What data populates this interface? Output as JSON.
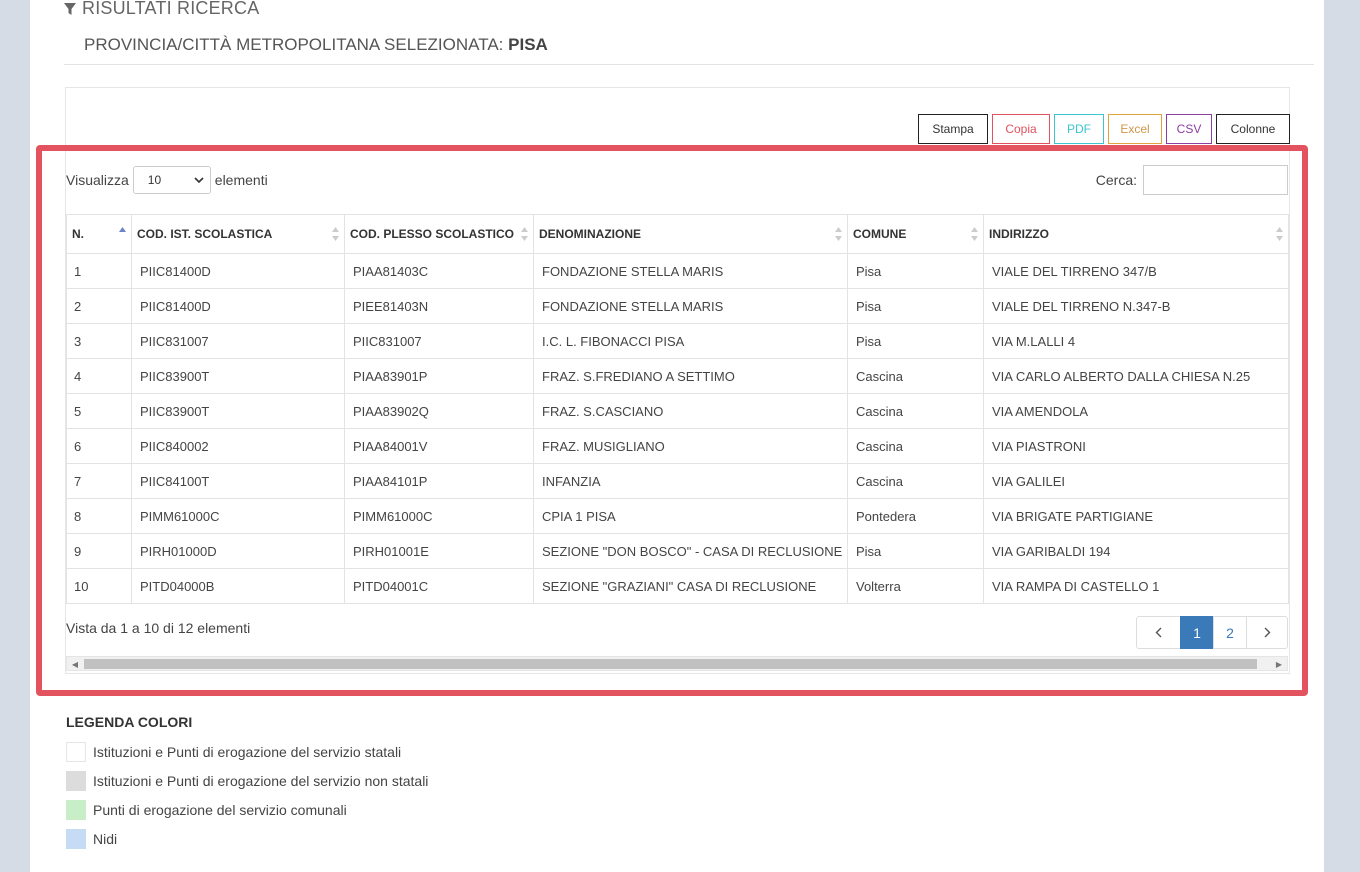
{
  "header": {
    "title": "RISULTATI RICERCA",
    "province_label": "PROVINCIA/CITTÀ METROPOLITANA SELEZIONATA:",
    "province_value": "PISA"
  },
  "toolbar": {
    "buttons": [
      "Stampa",
      "Copia",
      "PDF",
      "Excel",
      "CSV",
      "Colonne"
    ],
    "colors": {
      "copia": "#e0525f",
      "pdf": "#3cc4cf",
      "excel": "#e0a23f",
      "csv": "#8a3fa1"
    }
  },
  "controls": {
    "show_label": "Visualizza",
    "page_size": "10",
    "elements_label": "elementi",
    "search_label": "Cerca:",
    "search_value": ""
  },
  "table": {
    "columns": [
      "N.",
      "COD. IST. SCOLASTICA",
      "COD. PLESSO SCOLASTICO",
      "DENOMINAZIONE",
      "COMUNE",
      "INDIRIZZO"
    ],
    "rows": [
      [
        "1",
        "PIIC81400D",
        "PIAA81403C",
        "FONDAZIONE STELLA MARIS",
        "Pisa",
        "VIALE DEL TIRRENO 347/B"
      ],
      [
        "2",
        "PIIC81400D",
        "PIEE81403N",
        "FONDAZIONE STELLA MARIS",
        "Pisa",
        "VIALE DEL TIRRENO N.347-B"
      ],
      [
        "3",
        "PIIC831007",
        "PIIC831007",
        "I.C. L. FIBONACCI PISA",
        "Pisa",
        "VIA M.LALLI 4"
      ],
      [
        "4",
        "PIIC83900T",
        "PIAA83901P",
        "FRAZ. S.FREDIANO A SETTIMO",
        "Cascina",
        "VIA CARLO ALBERTO DALLA CHIESA N.25"
      ],
      [
        "5",
        "PIIC83900T",
        "PIAA83902Q",
        "FRAZ. S.CASCIANO",
        "Cascina",
        "VIA AMENDOLA"
      ],
      [
        "6",
        "PIIC840002",
        "PIAA84001V",
        "FRAZ. MUSIGLIANO",
        "Cascina",
        "VIA PIASTRONI"
      ],
      [
        "7",
        "PIIC84100T",
        "PIAA84101P",
        "INFANZIA",
        "Cascina",
        "VIA GALILEI"
      ],
      [
        "8",
        "PIMM61000C",
        "PIMM61000C",
        "CPIA 1 PISA",
        "Pontedera",
        "VIA BRIGATE PARTIGIANE"
      ],
      [
        "9",
        "PIRH01000D",
        "PIRH01001E",
        "SEZIONE \"DON BOSCO\" - CASA DI RECLUSIONE",
        "Pisa",
        "VIA GARIBALDI 194"
      ],
      [
        "10",
        "PITD04000B",
        "PITD04001C",
        "SEZIONE \"GRAZIANI\" CASA DI RECLUSIONE",
        "Volterra",
        "VIA RAMPA DI CASTELLO 1"
      ]
    ]
  },
  "footer": {
    "info": "Vista da 1 a 10 di 12 elementi",
    "pages": [
      "1",
      "2"
    ],
    "current_page": "1"
  },
  "legend": {
    "title": "LEGENDA COLORI",
    "items": [
      {
        "label": "Istituzioni e Punti di erogazione del servizio statali",
        "color": "#ffffff"
      },
      {
        "label": "Istituzioni e Punti di erogazione del servizio non statali",
        "color": "#dcdcdc"
      },
      {
        "label": "Punti di erogazione del servizio comunali",
        "color": "#c8eec8"
      },
      {
        "label": "Nidi",
        "color": "#c5dcf4"
      }
    ]
  },
  "accent": {
    "highlight_border": "#e2535f",
    "pagination_active": "#3a7ab8"
  }
}
